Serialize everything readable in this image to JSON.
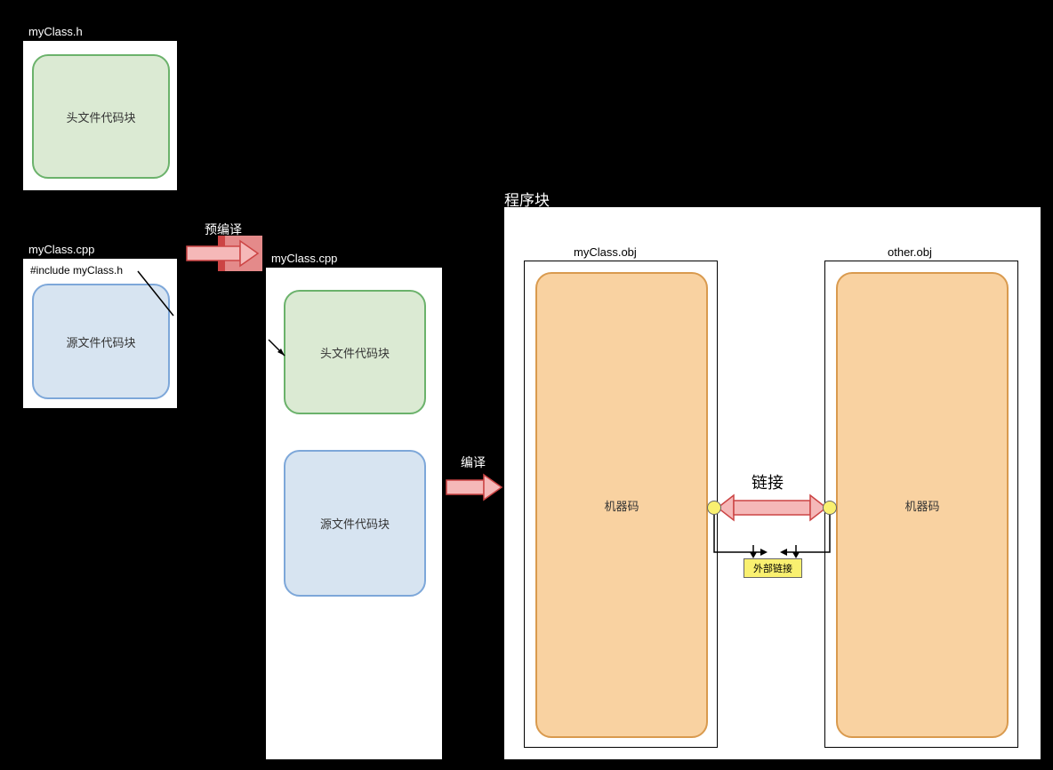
{
  "files": {
    "header": {
      "title": "myClass.h",
      "block": "头文件代码块",
      "color": "#dbead3",
      "border": "#6bb26b"
    },
    "source": {
      "title": "myClass.cpp",
      "include": "#include myClass.h",
      "block": "源文件代码块",
      "color": "#d7e4f1",
      "border": "#7da7d9"
    }
  },
  "stage1": {
    "arrow_label": "预编译",
    "header_block": "头文件代码块",
    "source_block": "源文件代码块"
  },
  "stage2": {
    "arrow_label": "编译"
  },
  "program": {
    "title": "程序块",
    "obj1": {
      "name": "myClass.obj",
      "block": "机器码"
    },
    "obj2": {
      "name": "other.obj",
      "block": "机器码"
    },
    "link_label": "链接",
    "external_link": "外部链接",
    "obj_color": "#f9d2a1",
    "obj_border": "#d99a4e"
  }
}
